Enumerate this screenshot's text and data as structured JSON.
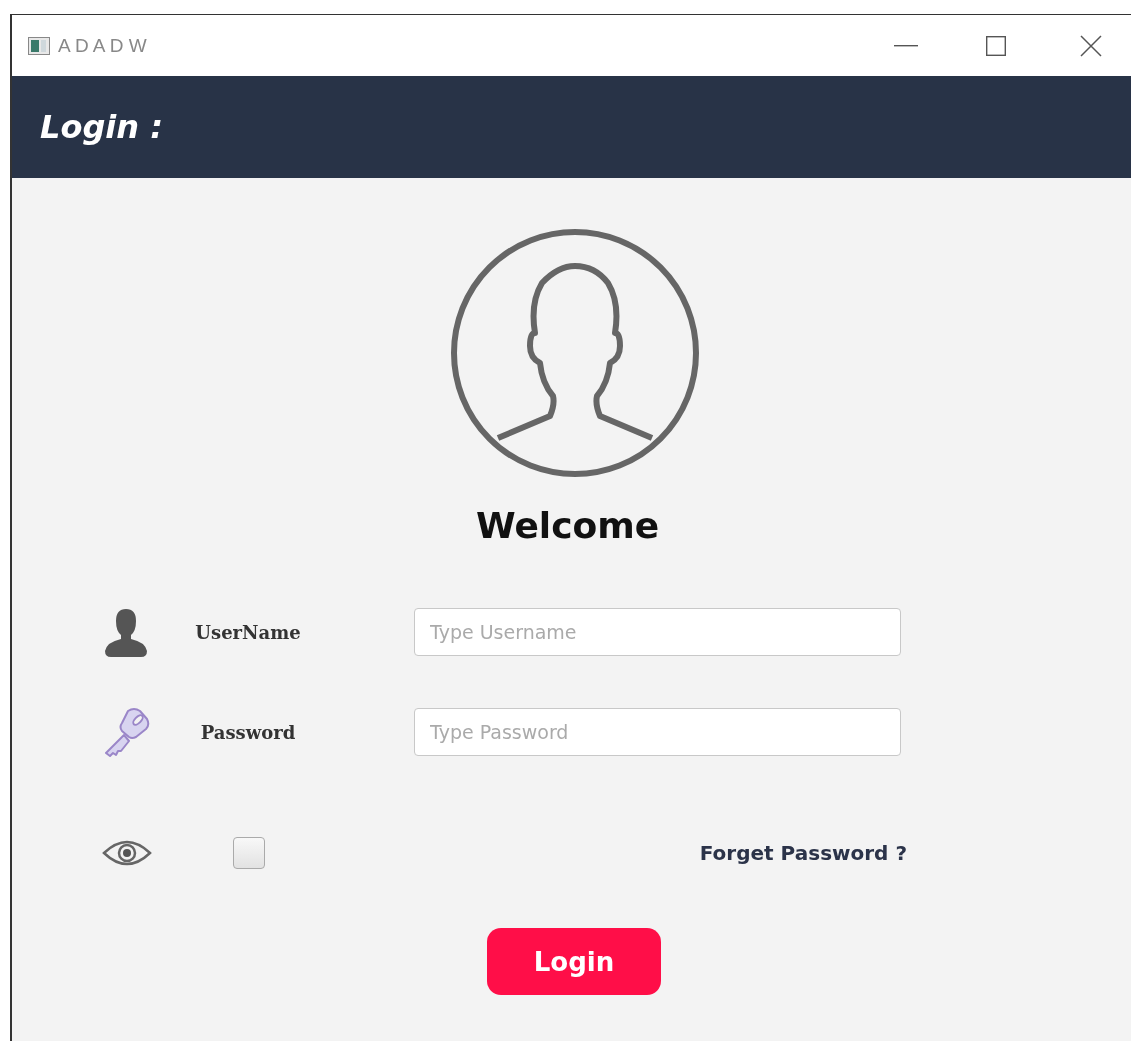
{
  "window": {
    "title": "A D A D W"
  },
  "header": {
    "title": "Login :"
  },
  "welcome": "Welcome",
  "fields": [
    {
      "kind": "username",
      "label": "UserName",
      "placeholder": "Type Username"
    },
    {
      "kind": "password",
      "label": "Password",
      "placeholder": "Type Password"
    }
  ],
  "show_password": {
    "checked": false
  },
  "forgot_link": "Forget Password ?",
  "login_button": "Login"
}
